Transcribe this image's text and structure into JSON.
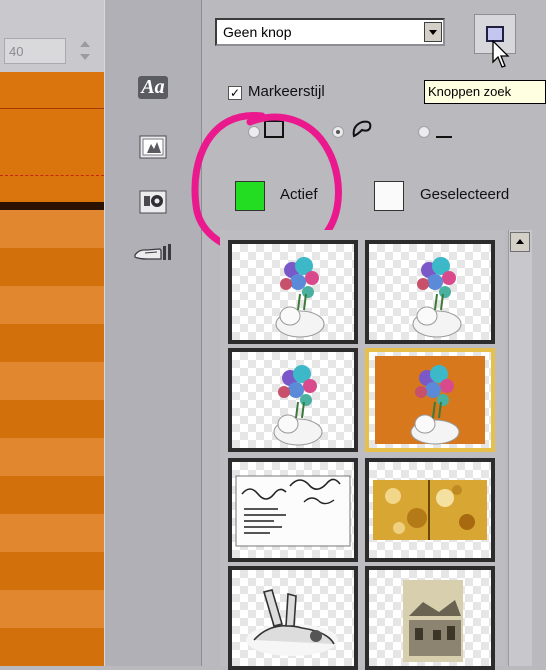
{
  "left": {
    "zoom_value": "40"
  },
  "tools": {
    "text_tool_label": "Aa"
  },
  "button_type": {
    "selected": "Geen knop"
  },
  "tooltip": "Knoppen zoek",
  "highlight": {
    "checkbox_label": "Markeerstijl",
    "checked": true
  },
  "colors": {
    "active_label": "Actief",
    "active_color": "#22dd22",
    "selected_label": "Geselecteerd",
    "selected_color": "#fafafa"
  },
  "thumbnails": [
    {
      "name": "flower-vase-1"
    },
    {
      "name": "flower-vase-2"
    },
    {
      "name": "flower-vase-3"
    },
    {
      "name": "flower-vase-orange",
      "selected": true
    },
    {
      "name": "handwritten-card"
    },
    {
      "name": "gold-texture"
    },
    {
      "name": "cartoon-rabbit"
    },
    {
      "name": "old-street-photo"
    }
  ]
}
